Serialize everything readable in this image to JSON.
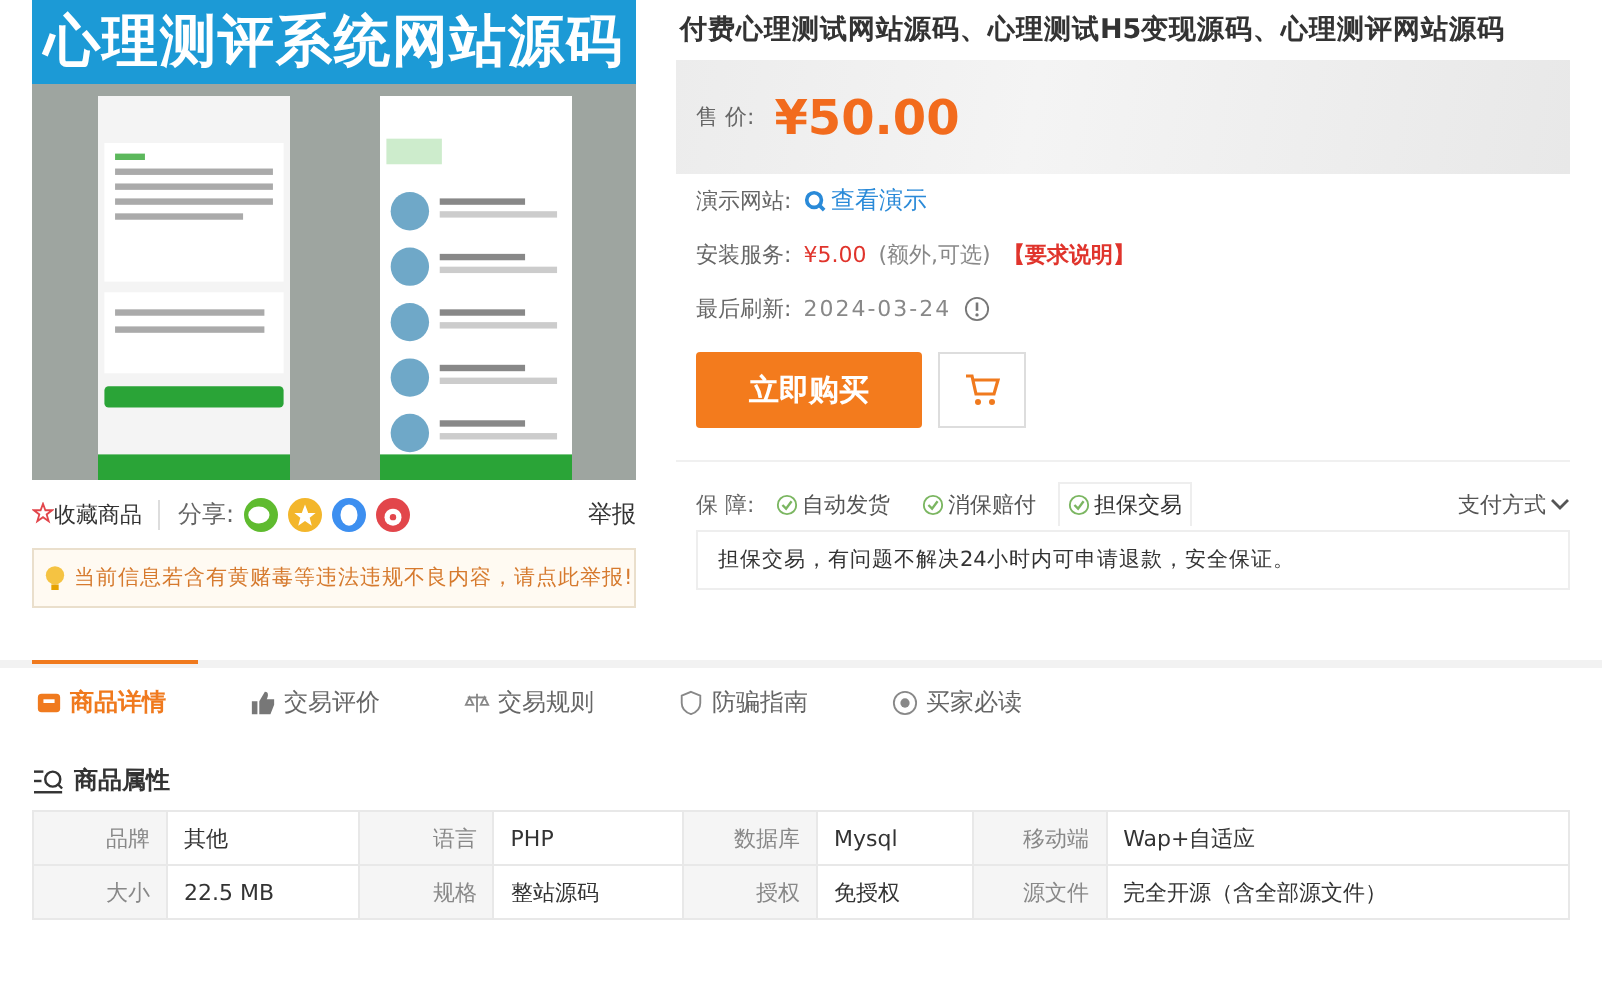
{
  "product_image": {
    "banner": "心理测评系统网站源码"
  },
  "actions": {
    "favorite": "收藏商品",
    "share": "分享:",
    "share_icons": [
      {
        "kind": "wechat",
        "color": "#5fbb2f"
      },
      {
        "kind": "star",
        "color": "#f3b62b"
      },
      {
        "kind": "qq",
        "color": "#3d8ff0"
      },
      {
        "kind": "weibo",
        "color": "#e2464b"
      }
    ],
    "report": "举报"
  },
  "notice": "当前信息若含有黄赌毒等违法违规不良内容，请点此举报!",
  "title": "付费心理测试网站源码、心理测试H5变现源码、心理测评网站源码",
  "price": {
    "label": "售 价:",
    "value": "¥50.00"
  },
  "demo": {
    "label": "演示网站:",
    "link": "查看演示"
  },
  "install": {
    "label": "安装服务:",
    "price": "¥5.00",
    "note": "(额外,可选)",
    "link": "【要求说明】"
  },
  "refresh": {
    "label": "最后刷新:",
    "date": "2024-03-24"
  },
  "buy_button": "立即购买",
  "guarantee": {
    "label": "保 障:",
    "items": [
      {
        "label": "自动发货",
        "selected": false
      },
      {
        "label": "消保赔付",
        "selected": false
      },
      {
        "label": "担保交易",
        "selected": true
      }
    ],
    "payment": "支付方式",
    "description": "担保交易，有问题不解决24小时内可申请退款，安全保证。"
  },
  "tabs": [
    {
      "label": "商品详情",
      "kind": "detail",
      "selected": true
    },
    {
      "label": "交易评价",
      "kind": "thumb",
      "selected": false
    },
    {
      "label": "交易规则",
      "kind": "scale",
      "selected": false
    },
    {
      "label": "防骗指南",
      "kind": "shield",
      "selected": false
    },
    {
      "label": "买家必读",
      "kind": "circle",
      "selected": false
    }
  ],
  "attributes": {
    "title": "商品属性",
    "rows": [
      [
        {
          "name": "品牌",
          "value": "其他"
        },
        {
          "name": "语言",
          "value": "PHP"
        },
        {
          "name": "数据库",
          "value": "Mysql"
        },
        {
          "name": "移动端",
          "value": "Wap+自适应"
        }
      ],
      [
        {
          "name": "大小",
          "value": "22.5 MB"
        },
        {
          "name": "规格",
          "value": "整站源码"
        },
        {
          "name": "授权",
          "value": "免授权"
        },
        {
          "name": "源文件",
          "value": "完全开源（含全部源文件）"
        }
      ]
    ]
  }
}
